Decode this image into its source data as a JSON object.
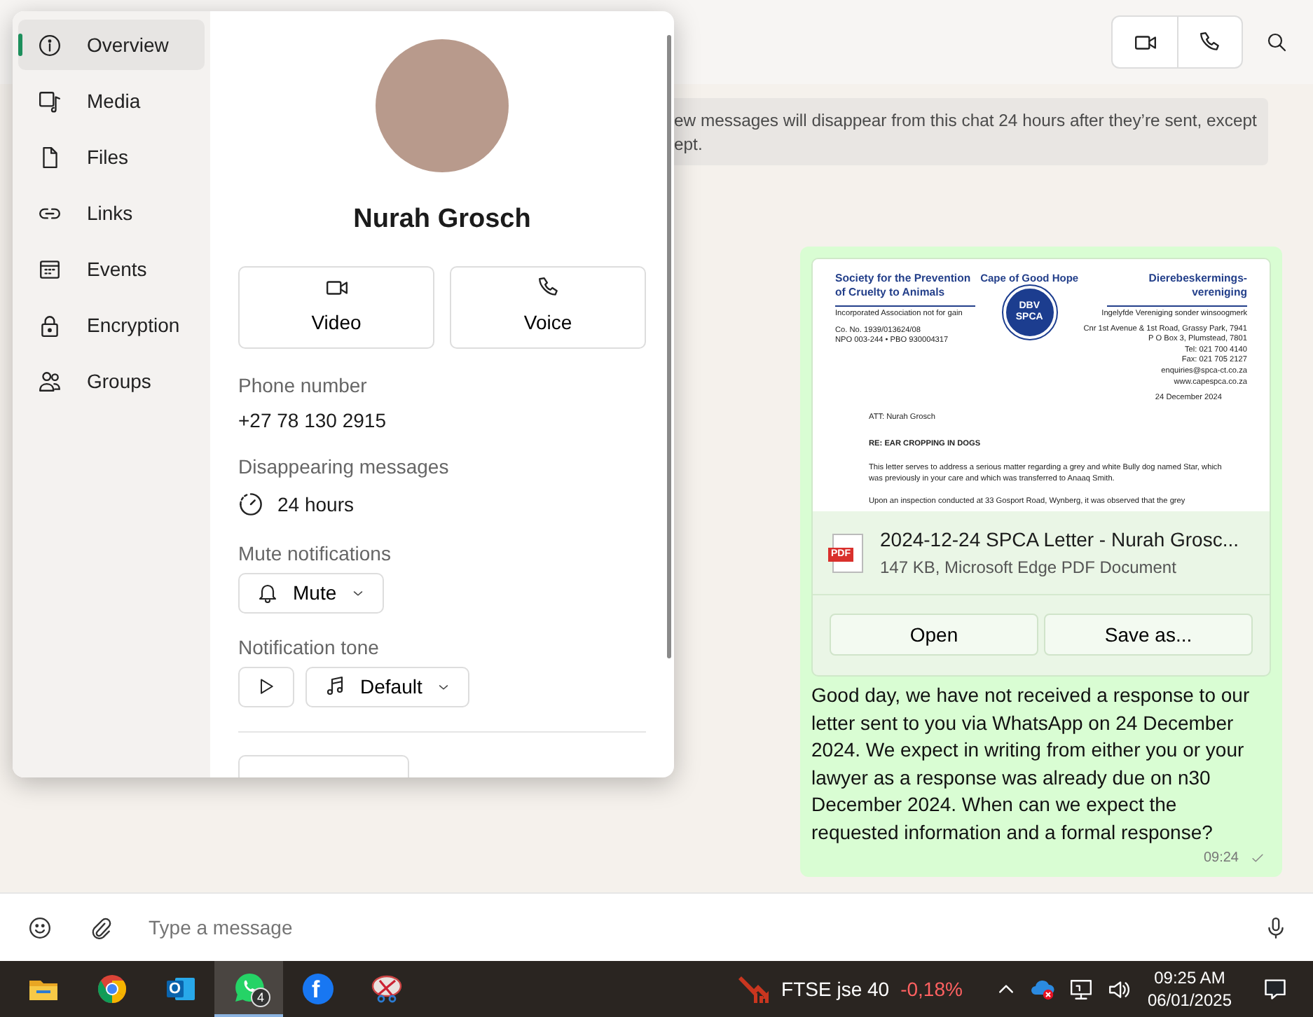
{
  "header": {
    "call_buttons": [
      {
        "kind": "video"
      },
      {
        "kind": "voice"
      }
    ]
  },
  "chat": {
    "notice_lines": [
      "ew messages will disappear from this chat 24 hours after they’re sent, except",
      "ept."
    ],
    "message": {
      "document": {
        "org_left": [
          "Society for the Prevention",
          "of Cruelty to Animals"
        ],
        "org_center": "Cape of Good Hope",
        "logo_lines": [
          "DBV",
          "SPCA"
        ],
        "org_right": [
          "Dierebeskermings-",
          "vereniging"
        ],
        "tag_left": "Incorporated Association not for gain",
        "tag_right": "Ingelyfde Vereniging sonder winsoogmerk",
        "reg_lines": [
          "Co. No. 1939/013624/08",
          "NPO 003-244 • PBO 930004317"
        ],
        "address_lines": [
          "Cnr 1st Avenue & 1st Road, Grassy Park, 7941",
          "P O Box 3, Plumstead, 7801",
          "Tel: 021 700 4140",
          "Fax: 021 705 2127",
          "enquiries@spca-ct.co.za",
          "www.capespca.co.za"
        ],
        "date": "24 December 2024",
        "att": "ATT: Nurah Grosch",
        "subject": "RE: EAR CROPPING IN DOGS",
        "paragraphs": [
          "This letter serves to address a serious matter regarding a grey and white Bully dog named Star, which was previously in your care and which was transferred to Anaaq Smith.",
          "Upon an inspection conducted at 33 Gosport Road, Wynberg, it was observed that the grey"
        ]
      },
      "file": {
        "badge": "PDF",
        "name": "2024-12-24 SPCA Letter - Nurah Grosc...",
        "details": "147 KB, Microsoft Edge PDF Document"
      },
      "actions": [
        "Open",
        "Save as..."
      ],
      "text": "Good day, we have not received a response to our letter sent to you via WhatsApp on 24 December 2024. We expect in writing from either you or your lawyer as a response was already due on n30 December 2024. When can we expect the requested information and a formal response?",
      "time": "09:24"
    }
  },
  "composer": {
    "placeholder": "Type a message"
  },
  "contact_panel": {
    "nav": [
      {
        "kind": "info",
        "label": "Overview",
        "selected": true
      },
      {
        "kind": "media",
        "label": "Media",
        "selected": false
      },
      {
        "kind": "file",
        "label": "Files",
        "selected": false
      },
      {
        "kind": "link",
        "label": "Links",
        "selected": false
      },
      {
        "kind": "calendar",
        "label": "Events",
        "selected": false
      },
      {
        "kind": "lock",
        "label": "Encryption",
        "selected": false
      },
      {
        "kind": "people",
        "label": "Groups",
        "selected": false
      }
    ],
    "name": "Nurah Grosch",
    "call_buttons": [
      {
        "kind": "video",
        "label": "Video"
      },
      {
        "kind": "voice",
        "label": "Voice"
      }
    ],
    "phone_label": "Phone number",
    "phone": "+27 78 130 2915",
    "disappearing_label": "Disappearing messages",
    "disappearing_value": "24 hours",
    "mute_label": "Mute notifications",
    "mute_button": "Mute",
    "tone_label": "Notification tone",
    "tone_value": "Default"
  },
  "taskbar": {
    "apps": [
      {
        "kind": "folder",
        "active": false
      },
      {
        "kind": "chrome",
        "active": false
      },
      {
        "kind": "outlook",
        "active": false,
        "logo_text": "O"
      },
      {
        "kind": "whatsapp",
        "active": true,
        "badge": "4"
      },
      {
        "kind": "facebook",
        "active": false,
        "logo_text": "f"
      },
      {
        "kind": "snip",
        "active": false
      }
    ],
    "stock": {
      "name": "FTSE jse 40",
      "change": "-0,18%"
    },
    "time": "09:25 AM",
    "date": "06/01/2025"
  }
}
